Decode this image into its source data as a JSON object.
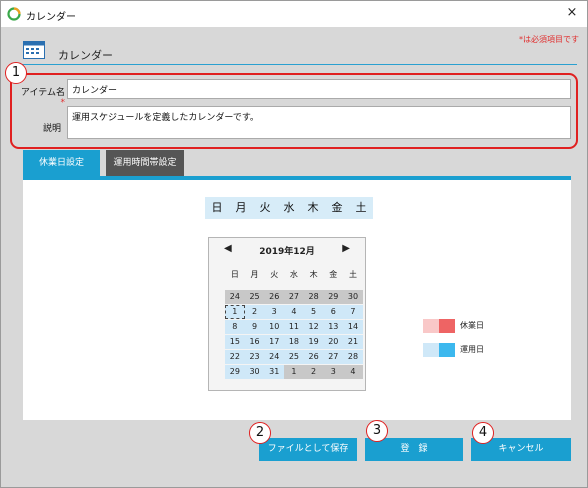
{
  "window": {
    "title": "カレンダー",
    "close_glyph": "×",
    "icon": "app-calendar-icon"
  },
  "header": {
    "title": "カレンダー",
    "icon": "calendar-grid-icon",
    "required_note": "*は必須項目です"
  },
  "form": {
    "item_name_label": "アイテム名",
    "required_mark": "*",
    "item_name_value": "カレンダー",
    "description_label": "説明",
    "description_value": "運用スケジュールを定義したカレンダーです。"
  },
  "tabs": {
    "holiday": "休業日設定",
    "hours": "運用時間帯設定"
  },
  "weekdays": [
    "日",
    "月",
    "火",
    "水",
    "木",
    "金",
    "土"
  ],
  "calendar": {
    "title": "2019年12月",
    "prev": "◀",
    "next": "▶",
    "headers": [
      "日",
      "月",
      "火",
      "水",
      "木",
      "金",
      "土"
    ],
    "rows": [
      [
        "24",
        "25",
        "26",
        "27",
        "28",
        "29",
        "30"
      ],
      [
        "1",
        "2",
        "3",
        "4",
        "5",
        "6",
        "7"
      ],
      [
        "8",
        "9",
        "10",
        "11",
        "12",
        "13",
        "14"
      ],
      [
        "15",
        "16",
        "17",
        "18",
        "19",
        "20",
        "21"
      ],
      [
        "22",
        "23",
        "24",
        "25",
        "26",
        "27",
        "28"
      ],
      [
        "29",
        "30",
        "31",
        "1",
        "2",
        "3",
        "4"
      ]
    ]
  },
  "legend": {
    "holiday_label": "休業日",
    "workday_label": "運用日",
    "holiday_colors": [
      "#f9c8c8",
      "#ee6464"
    ],
    "workday_colors": [
      "#cfe8f8",
      "#3cb8ee"
    ]
  },
  "buttons": {
    "save_file": "ファイルとして保存",
    "register": "登　録",
    "cancel": "キャンセル"
  },
  "badges": [
    "1",
    "2",
    "3",
    "4"
  ],
  "colors": {
    "accent": "#1a9fd0",
    "annotation": "#e02020"
  }
}
